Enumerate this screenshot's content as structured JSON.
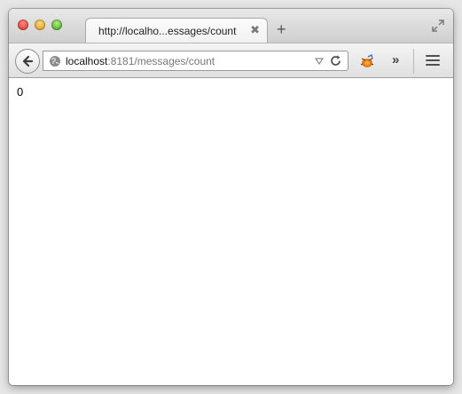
{
  "tab": {
    "title": "http://localho...essages/count",
    "close_glyph": "✖",
    "new_tab_glyph": "+"
  },
  "urlbar": {
    "host": "localhost",
    "rest": ":8181/messages/count"
  },
  "toolbar": {
    "overflow_glyph": "»"
  },
  "page": {
    "content": "0"
  },
  "icons": {
    "back": "back-arrow-icon",
    "site": "globe-icon",
    "dropmarker": "chevron-down-icon",
    "reload": "reload-icon",
    "addon": "bug-addon-icon",
    "menu": "hamburger-menu-icon",
    "fullscreen": "fullscreen-icon"
  },
  "colors": {
    "close": "#e0443b",
    "minimize": "#e3a52a",
    "maximize": "#56b42f"
  }
}
